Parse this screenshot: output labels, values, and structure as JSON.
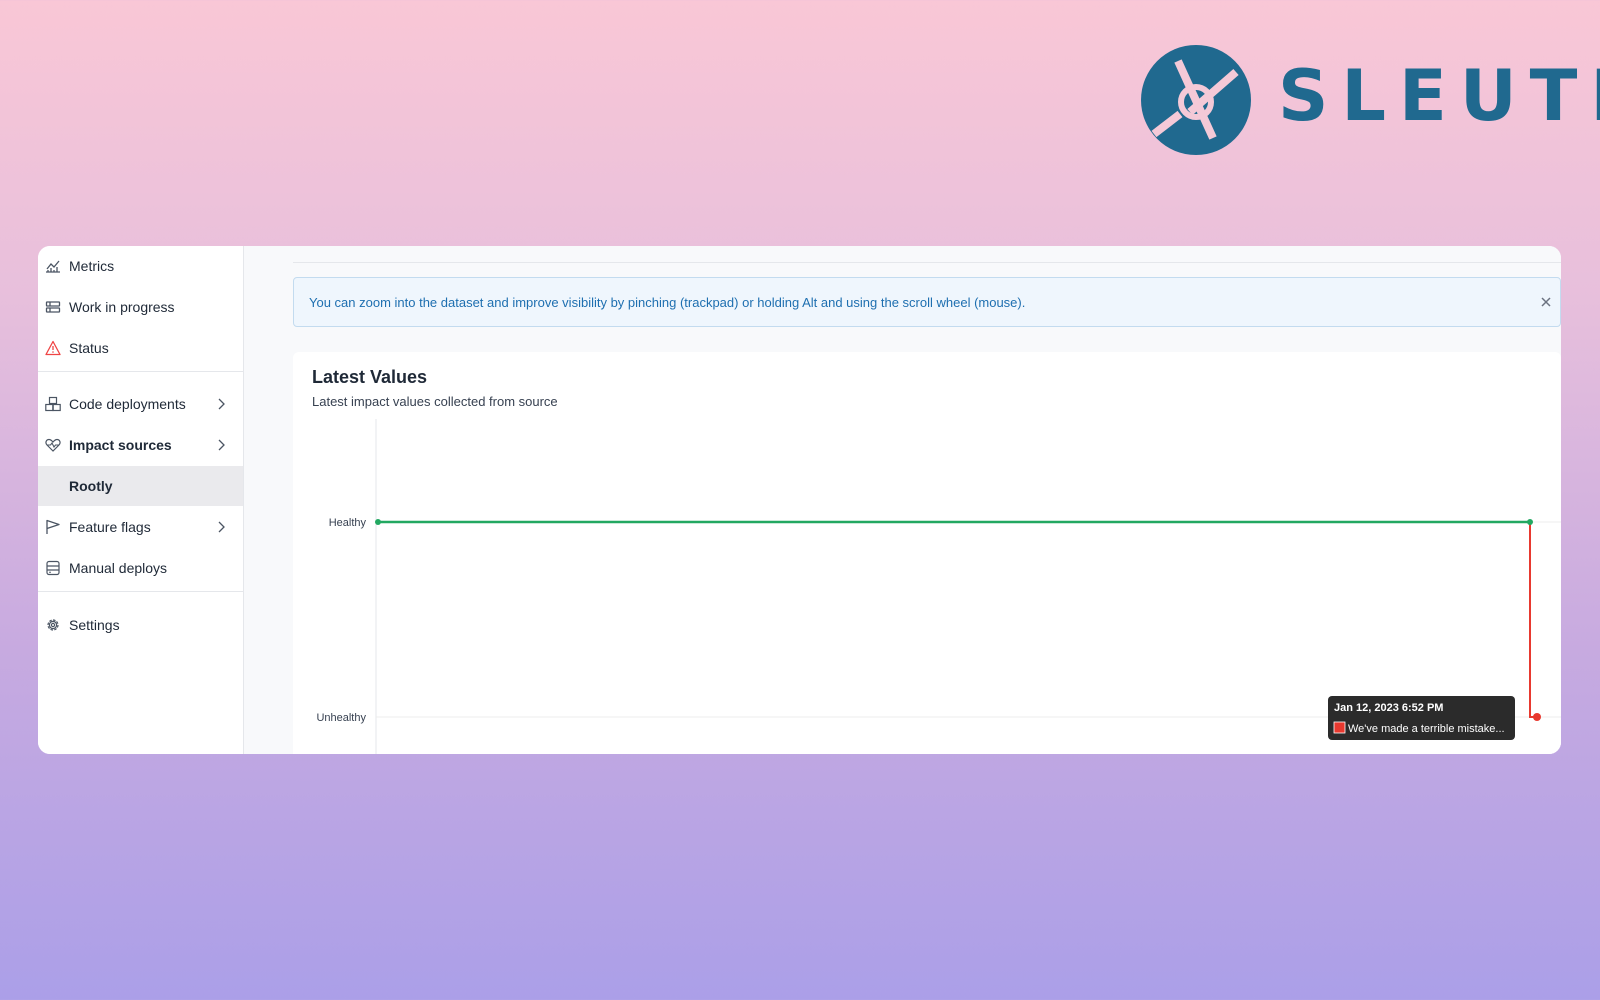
{
  "brand": {
    "name": "SLEUTH",
    "color": "#20698f"
  },
  "sidebar": {
    "items": [
      {
        "label": "Metrics",
        "icon": "chart-line-icon"
      },
      {
        "label": "Work in progress",
        "icon": "layers-icon"
      },
      {
        "label": "Status",
        "icon": "warning-triangle-icon"
      },
      {
        "label": "Code deployments",
        "icon": "cubes-icon"
      },
      {
        "label": "Impact sources",
        "icon": "heart-pulse-icon"
      },
      {
        "label": "Rootly"
      },
      {
        "label": "Feature flags",
        "icon": "flag-icon"
      },
      {
        "label": "Manual deploys",
        "icon": "server-icon"
      },
      {
        "label": "Settings",
        "icon": "gear-icon"
      }
    ],
    "selected": "Rootly",
    "status_icon_color": "#ef4444"
  },
  "banner": {
    "text": "You can zoom into the dataset and improve visibility by pinching (trackpad) or holding Alt and using the scroll wheel (mouse)."
  },
  "card": {
    "title": "Latest Values",
    "subtitle": "Latest impact values collected from source"
  },
  "chart_data": {
    "type": "line",
    "y_categories": [
      "Healthy",
      "Unhealthy"
    ],
    "series": [
      {
        "color": "#22a861",
        "y": [
          "Healthy",
          "Healthy"
        ]
      },
      {
        "color": "#e8392f",
        "y": [
          "Healthy",
          "Unhealthy"
        ]
      }
    ],
    "tooltip": {
      "title": "Jan 12, 2023 6:52 PM",
      "text": "We've made a terrible mistake...",
      "swatch_color": "#e8392f"
    },
    "grid": true
  }
}
